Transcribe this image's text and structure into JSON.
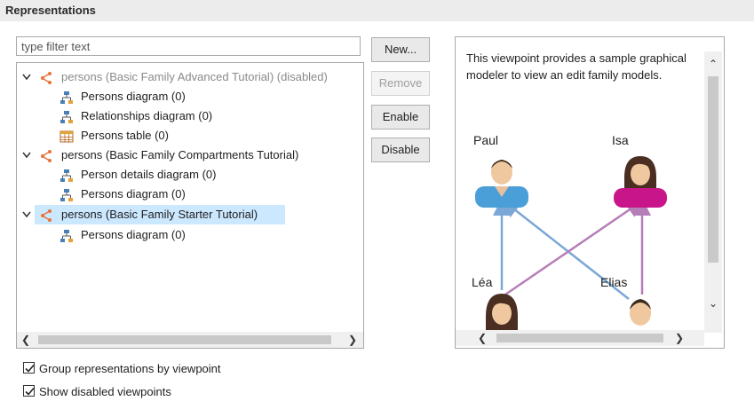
{
  "section": {
    "title": "Representations"
  },
  "filter": {
    "placeholder": "type filter text"
  },
  "tree": {
    "viewpoints": [
      {
        "label": "persons (Basic Family Advanced Tutorial) (disabled)",
        "disabled": true,
        "children": [
          {
            "label": "Persons diagram (0)",
            "icon": "diagram-icon"
          },
          {
            "label": "Relationships diagram (0)",
            "icon": "diagram-icon"
          },
          {
            "label": "Persons table (0)",
            "icon": "table-icon"
          }
        ]
      },
      {
        "label": "persons (Basic Family Compartments Tutorial)",
        "disabled": false,
        "children": [
          {
            "label": "Person details diagram (0)",
            "icon": "diagram-icon"
          },
          {
            "label": "Persons diagram (0)",
            "icon": "diagram-icon"
          }
        ]
      },
      {
        "label": "persons (Basic Family Starter Tutorial)",
        "disabled": false,
        "selected": true,
        "children": [
          {
            "label": "Persons diagram (0)",
            "icon": "diagram-icon"
          }
        ]
      }
    ]
  },
  "buttons": {
    "new": "New...",
    "remove": "Remove",
    "enable": "Enable",
    "disable": "Disable"
  },
  "preview": {
    "description": "This viewpoint provides a sample graphical modeler to view an edit family models.",
    "persons": [
      {
        "name": "Paul",
        "gender": "male",
        "shirt_color": "#4a9fd8"
      },
      {
        "name": "Isa",
        "gender": "female",
        "shirt_color": "#c8168a"
      },
      {
        "name": "Léa",
        "gender": "female",
        "shirt_color": "#c8168a"
      },
      {
        "name": "Elias",
        "gender": "male",
        "shirt_color": "#4a9fd8"
      }
    ],
    "edge_colors": {
      "blue": "#7ba7d6",
      "purple": "#b67eb8"
    }
  },
  "options": [
    {
      "label": "Group representations by viewpoint",
      "checked": true
    },
    {
      "label": "Show disabled viewpoints",
      "checked": true
    }
  ],
  "colors": {
    "viewpoint_icon": "#e8743b",
    "selection": "#cce8ff"
  }
}
